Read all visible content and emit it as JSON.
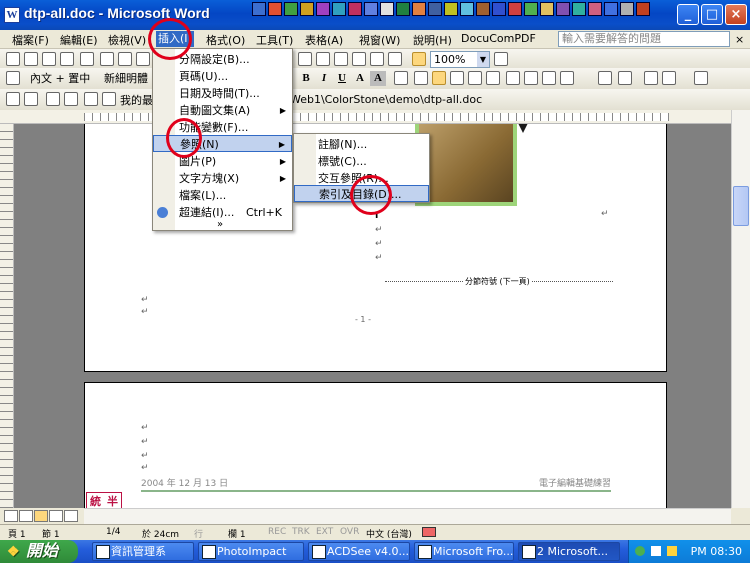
{
  "window": {
    "title": "dtp-all.doc - Microsoft Word",
    "app_icon": "W"
  },
  "menubar": {
    "items": [
      {
        "label": "檔案(F)"
      },
      {
        "label": "編輯(E)"
      },
      {
        "label": "檢視(V)"
      },
      {
        "label": "插入(I)"
      },
      {
        "label": "格式(O)"
      },
      {
        "label": "工具(T)"
      },
      {
        "label": "表格(A)"
      },
      {
        "label": "視窗(W)"
      },
      {
        "label": "說明(H)"
      },
      {
        "label": "DocuComPDF"
      }
    ],
    "help_placeholder": "輸入需要解答的問題",
    "close": "×"
  },
  "toolbar1": {
    "zoom": "100%"
  },
  "toolbar2": {
    "style": "內文 + 置中",
    "font": "新細明體",
    "bold": "B",
    "italic": "I",
    "underline": "U",
    "char_a": "A",
    "char_a_border": "A"
  },
  "toolbar3": {
    "address_left": "我的最",
    "address": "Web1\\ColorStone\\demo\\dtp-all.doc"
  },
  "insert_menu": {
    "items": [
      {
        "label": "分隔設定(B)..."
      },
      {
        "label": "頁碼(U)..."
      },
      {
        "label": "日期及時間(T)..."
      },
      {
        "label": "自動圖文集(A)",
        "submenu": true
      },
      {
        "label": "功能變數(F)..."
      },
      {
        "label": "參照(N)",
        "submenu": true
      },
      {
        "label": "圖片(P)",
        "submenu": true
      },
      {
        "label": "文字方塊(X)",
        "submenu": true
      },
      {
        "label": "檔案(L)..."
      },
      {
        "label": "超連結(I)...",
        "shortcut": "Ctrl+K"
      }
    ],
    "expand": "»"
  },
  "reference_menu": {
    "items": [
      {
        "label": "註腳(N)..."
      },
      {
        "label": "標號(C)..."
      },
      {
        "label": "交互參照(R)..."
      },
      {
        "label": "索引及目錄(D)..."
      }
    ]
  },
  "document": {
    "section_break": "分節符號 (下一頁)",
    "page_number": "- 1 -",
    "footer_date": "2004 年 12 月 13 日",
    "footer_title": "電子編輯基礎練習",
    "pilcrow": "↵",
    "ime": [
      "統",
      "半"
    ]
  },
  "statusbar": {
    "page": "頁 1",
    "section": "節 1",
    "pages": "1/4",
    "position": "於 24cm",
    "line": "行",
    "column": "欄 1",
    "rec": "REC",
    "trk": "TRK",
    "ext": "EXT",
    "ovr": "OVR",
    "language": "中文 (台灣)"
  },
  "taskbar": {
    "start": "開始",
    "tasks": [
      {
        "label": "資訊管理系"
      },
      {
        "label": "PhotoImpact"
      },
      {
        "label": "ACDSee v4.0..."
      },
      {
        "label": "Microsoft Fro..."
      },
      {
        "label": "2 Microsoft..."
      }
    ],
    "clock": "PM 08:30"
  },
  "colors": {
    "highlight": "#c1d2ee",
    "circle": "#e0001b",
    "title_bar": "#0a5fd8"
  }
}
